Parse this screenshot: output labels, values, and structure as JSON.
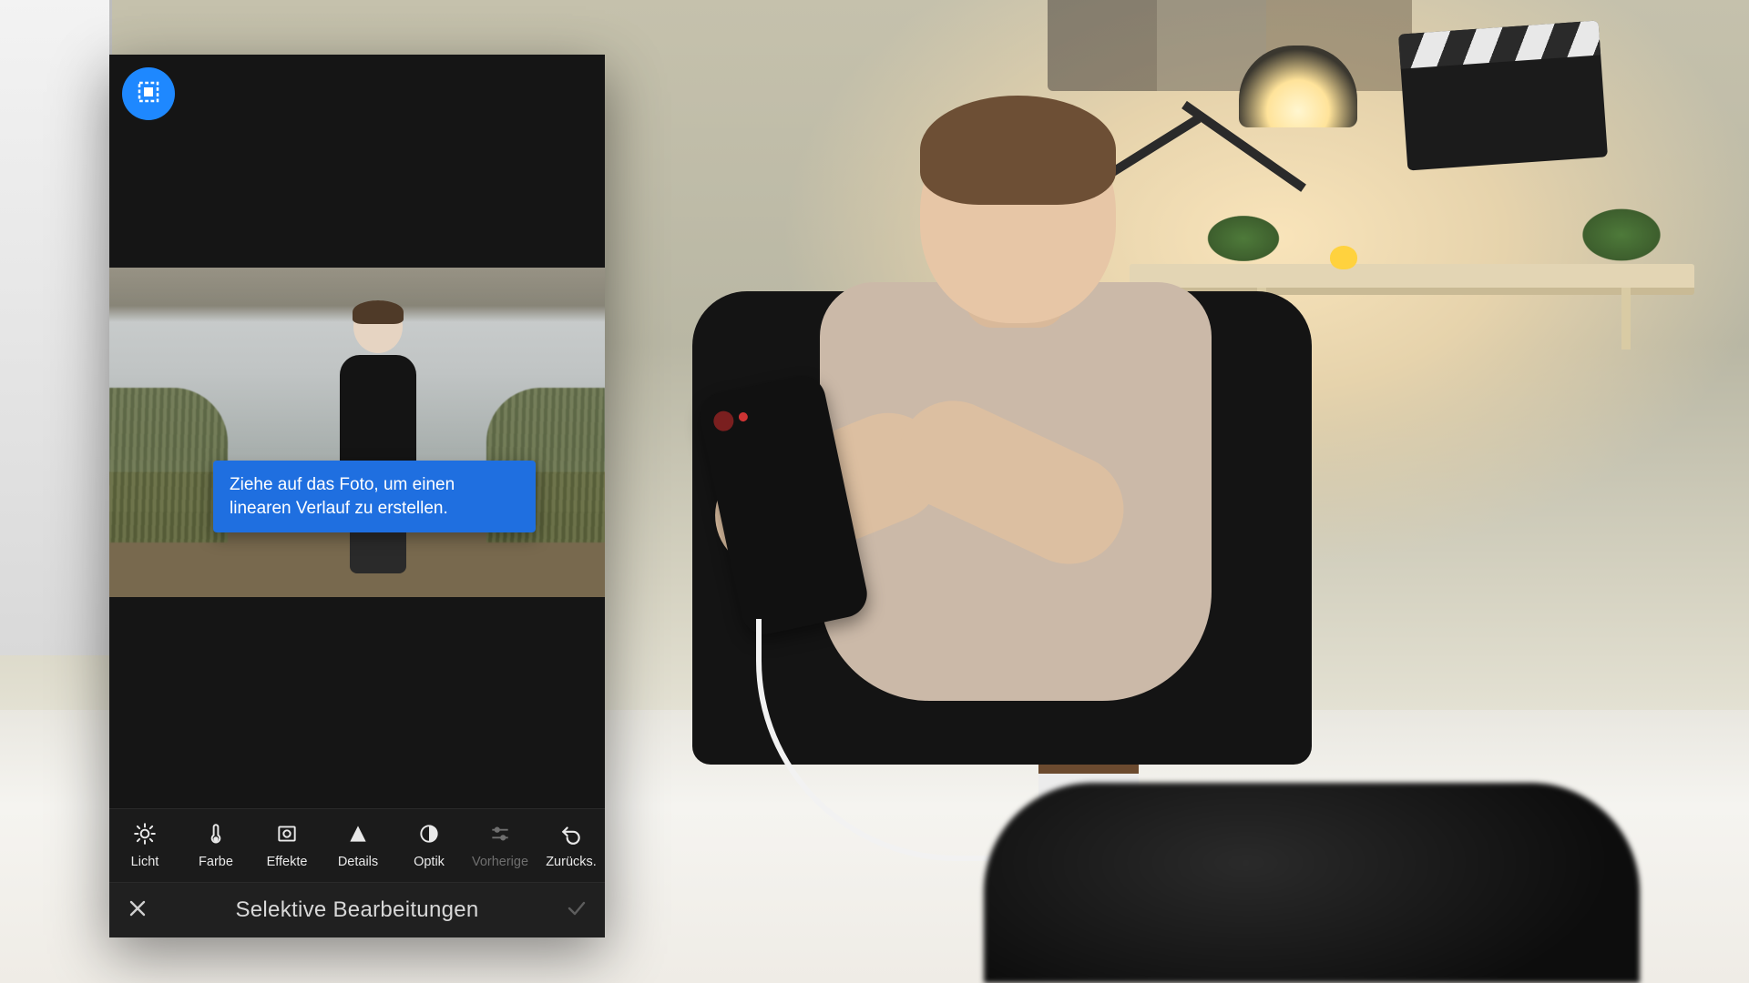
{
  "colors": {
    "accent": "#1f6fe0",
    "badge": "#1e88ff"
  },
  "badge": {
    "icon": "linear-gradient-selection"
  },
  "tooltip": {
    "text": "Ziehe auf das Foto, um einen linearen Verlauf zu erstellen."
  },
  "toolbar": {
    "items": [
      {
        "id": "licht",
        "label": "Licht",
        "icon": "sun-icon",
        "enabled": true
      },
      {
        "id": "farbe",
        "label": "Farbe",
        "icon": "thermometer-icon",
        "enabled": true
      },
      {
        "id": "effekte",
        "label": "Effekte",
        "icon": "vignette-icon",
        "enabled": true
      },
      {
        "id": "details",
        "label": "Details",
        "icon": "triangle-icon",
        "enabled": true
      },
      {
        "id": "optik",
        "label": "Optik",
        "icon": "lens-icon",
        "enabled": true
      },
      {
        "id": "vorherige",
        "label": "Vorherige",
        "icon": "sliders-icon",
        "enabled": false
      },
      {
        "id": "zuruecks",
        "label": "Zurücks.",
        "icon": "undo-icon",
        "enabled": true
      }
    ]
  },
  "bottom": {
    "title": "Selektive Bearbeitungen",
    "cancel_icon": "close-icon",
    "confirm_icon": "check-icon",
    "confirm_enabled": false
  }
}
